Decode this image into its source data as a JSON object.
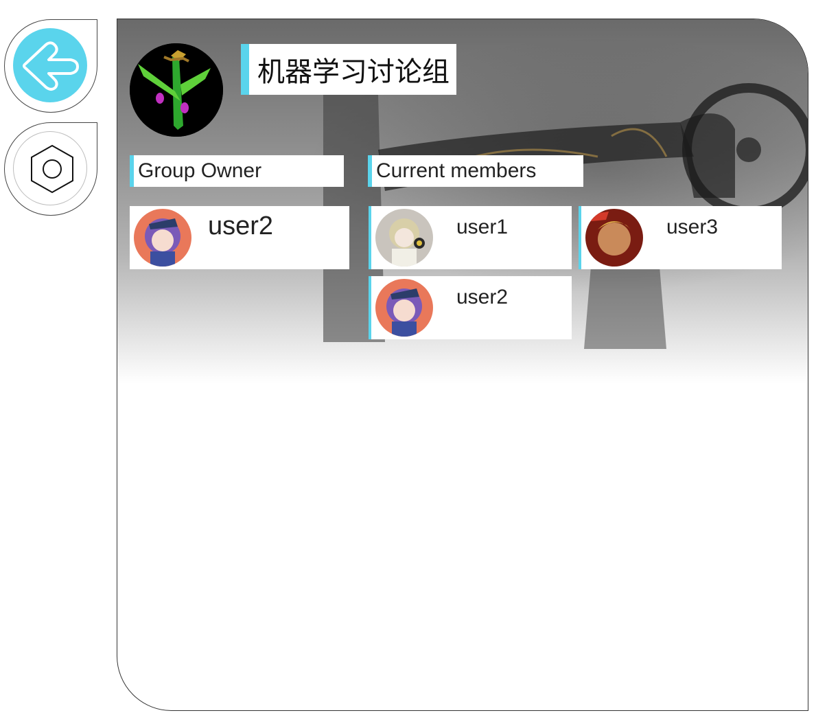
{
  "nav": {
    "back_icon": "arrow-left-icon",
    "settings_icon": "hexagon-nut-icon",
    "accent": "#5ad4ec"
  },
  "group": {
    "title": "机器学习讨论组",
    "avatar_icon": "airplane-pointcloud-icon"
  },
  "sections": {
    "owner_label": "Group Owner",
    "members_label": "Current members"
  },
  "owner": {
    "name": "user2"
  },
  "members": [
    {
      "name": "user1"
    },
    {
      "name": "user3"
    },
    {
      "name": "user2"
    }
  ]
}
